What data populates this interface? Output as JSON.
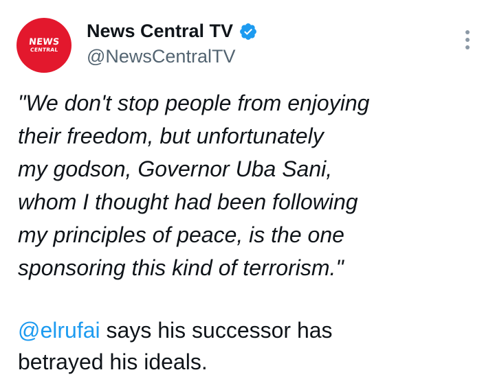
{
  "author": {
    "display_name": "News Central TV",
    "handle": "@NewsCentralTV",
    "verified": true,
    "avatar": {
      "logo_top": "NEWS",
      "logo_bottom": "CENTRAL",
      "bg_color": "#e3182d"
    }
  },
  "colors": {
    "link": "#1d9bf0",
    "secondary_text": "#536471",
    "verified_badge": "#1d9bf0"
  },
  "quote_lines": [
    "\"We don't stop people from enjoying",
    "their freedom, but unfortunately",
    "my godson, Governor Uba Sani,",
    "whom I thought had been following",
    "my principles of peace, is the one",
    "sponsoring this kind of terrorism.\""
  ],
  "body": {
    "mention": "@elrufai",
    "line1_rest": " says his successor has",
    "line2": "betrayed his ideals."
  },
  "icons": {
    "verified": "verified-badge-icon",
    "more": "more-options-icon"
  }
}
